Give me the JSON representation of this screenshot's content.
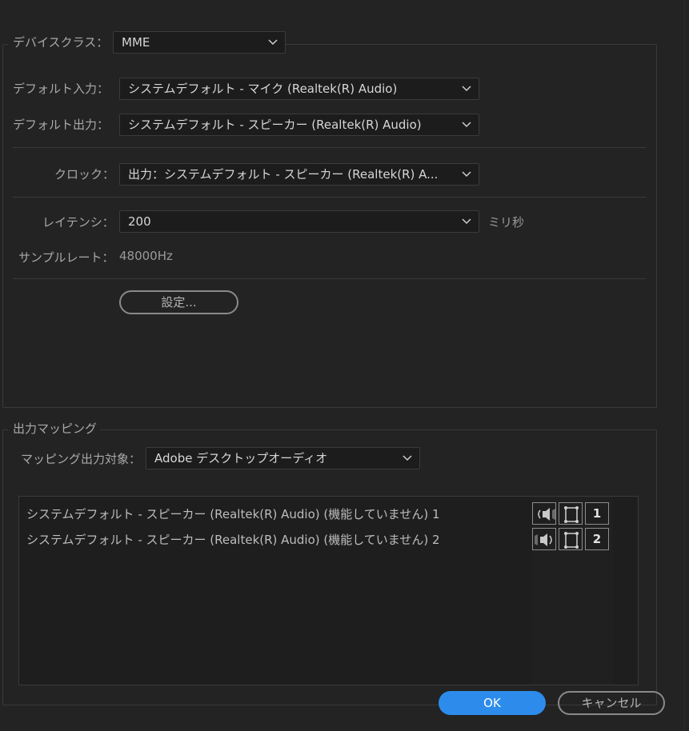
{
  "device": {
    "class_label": "デバイスクラス：",
    "class_value": "MME",
    "default_input_label": "デフォルト入力：",
    "default_input_value": "システムデフォルト - マイク (Realtek(R) Audio)",
    "default_output_label": "デフォルト出力：",
    "default_output_value": "システムデフォルト - スピーカー (Realtek(R) Audio)",
    "clock_label": "クロック：",
    "clock_value": "出力：システムデフォルト - スピーカー (Realtek(R) A...",
    "latency_label": "レイテンシ：",
    "latency_value": "200",
    "latency_unit": "ミリ秒",
    "samplerate_label": "サンプルレート：",
    "samplerate_value": "48000Hz",
    "settings_button": "設定..."
  },
  "mapping": {
    "section_title": "出力マッピング",
    "target_label": "マッピング出力対象：",
    "target_value": "Adobe デスクトップオーディオ",
    "rows": [
      {
        "text": "システムデフォルト - スピーカー (Realtek(R) Audio) (機能していません) 1",
        "channel": "1",
        "speaker_icon": "speaker-left-icon"
      },
      {
        "text": "システムデフォルト - スピーカー (Realtek(R) Audio) (機能していません) 2",
        "channel": "2",
        "speaker_icon": "speaker-right-icon"
      }
    ]
  },
  "footer": {
    "ok_label": "OK",
    "cancel_label": "キャンセル"
  },
  "colors": {
    "background": "#232323",
    "primary_button": "#2d8ceb"
  }
}
